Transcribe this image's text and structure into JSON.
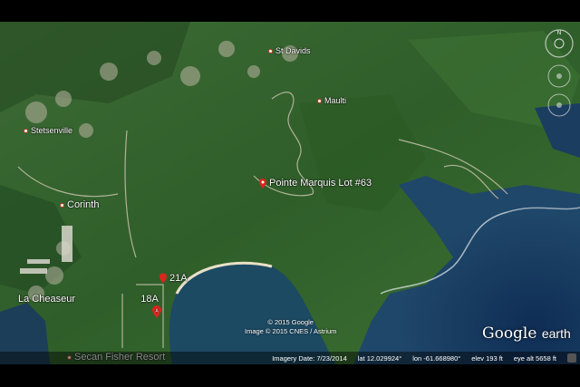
{
  "places": [
    {
      "id": "st-davids",
      "label": "St Davids"
    },
    {
      "id": "maulti",
      "label": "Maulti"
    },
    {
      "id": "stetsenville",
      "label": "Stetsenville"
    },
    {
      "id": "corinth",
      "label": "Corinth"
    },
    {
      "id": "la-chaseur",
      "label": "La Cheaseur"
    },
    {
      "id": "pointe-marquis",
      "label": "Pointe Marquis Lot #63"
    },
    {
      "id": "lot-21a",
      "label": "21A"
    },
    {
      "id": "lot-18a",
      "label": "18A"
    },
    {
      "id": "resort",
      "label": "Secan Fisher Resort"
    }
  ],
  "copyright": {
    "line1": "© 2015 Google",
    "line2": "Image © 2015 CNES / Astrium"
  },
  "logo": {
    "word1": "Google",
    "word2": "earth"
  },
  "status": {
    "imagery_date": "Imagery Date: 7/23/2014",
    "lat": "lat   12.029924°",
    "lon": "lon  -61.668980°",
    "elev": "elev   193 ft",
    "eye_alt": "eye alt   5658 ft"
  },
  "colors": {
    "land": "#2f5e2a",
    "sea": "#1d3f5e",
    "pin": "#d9261c"
  },
  "icons": {
    "compass": "compass-icon",
    "look": "look-joystick-icon",
    "move": "move-joystick-icon",
    "pin": "map-pin-icon"
  }
}
